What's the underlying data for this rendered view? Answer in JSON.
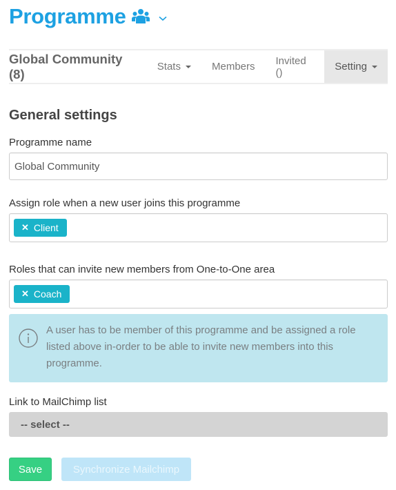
{
  "header": {
    "title": "Programme",
    "icon": "users-group-icon",
    "dropdown_icon": "chevron-down-icon",
    "accent_color": "#1da1e2"
  },
  "nav": {
    "brand": "Global Community (8)",
    "items": [
      {
        "label": "Stats",
        "has_caret": true,
        "active": false
      },
      {
        "label": "Members",
        "has_caret": false,
        "active": false
      },
      {
        "label": "Invited ()",
        "has_caret": false,
        "active": false
      },
      {
        "label": "Setting",
        "has_caret": true,
        "active": true
      }
    ]
  },
  "general_settings": {
    "title": "General settings",
    "programme_name": {
      "label": "Programme name",
      "value": "Global Community"
    },
    "assign_role": {
      "label": "Assign role when a new user joins this programme",
      "tags": [
        "Client"
      ]
    },
    "invite_roles": {
      "label": "Roles that can invite new members from One-to-One area",
      "tags": [
        "Coach"
      ]
    },
    "info": {
      "icon": "info-circle-icon",
      "text": "A user has to be member of this programme and be assigned a role listed above in-order to be able to invite new members into this programme."
    },
    "mailchimp": {
      "label": "Link to MailChimp list",
      "selected": "-- select --"
    }
  },
  "actions": {
    "save_label": "Save",
    "sync_label": "Synchronize Mailchimp",
    "save_color": "#36d083",
    "sync_color": "#bfe5f8"
  },
  "tag_color": "#1ab3c9"
}
